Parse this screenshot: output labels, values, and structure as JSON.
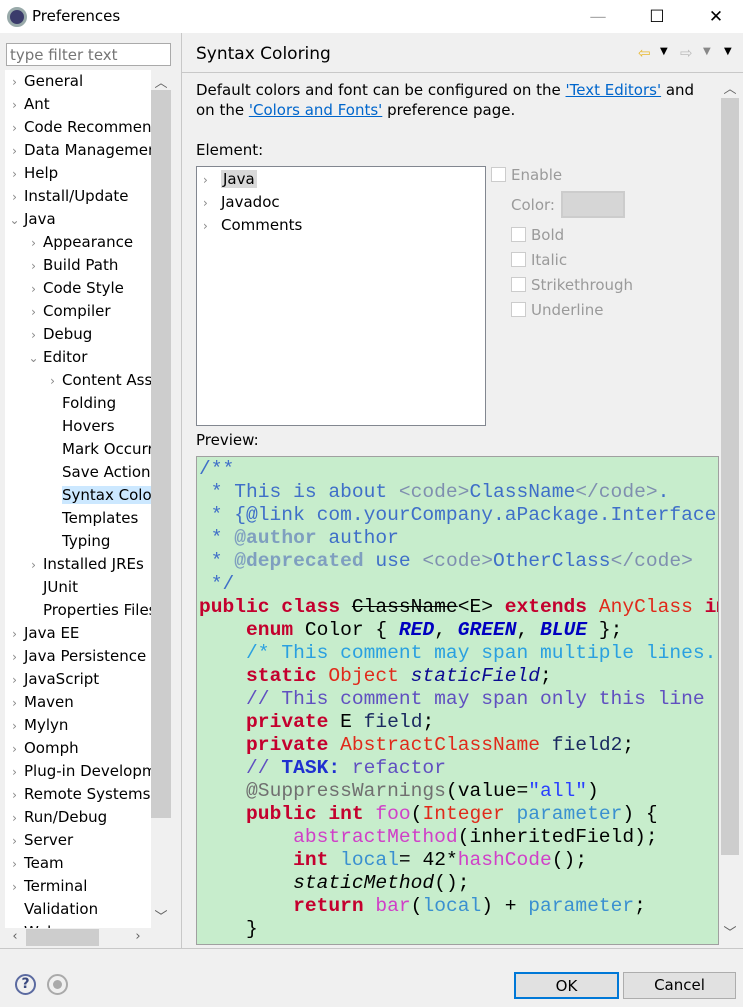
{
  "window": {
    "title": "Preferences",
    "minimize": "—",
    "maximize": "☐",
    "close": "✕"
  },
  "sidebar": {
    "filter_placeholder": "type filter text",
    "items": [
      {
        "label": "General",
        "level": 0,
        "arrow": "closed"
      },
      {
        "label": "Ant",
        "level": 0,
        "arrow": "closed"
      },
      {
        "label": "Code Recommenders",
        "level": 0,
        "arrow": "closed"
      },
      {
        "label": "Data Management",
        "level": 0,
        "arrow": "closed"
      },
      {
        "label": "Help",
        "level": 0,
        "arrow": "closed"
      },
      {
        "label": "Install/Update",
        "level": 0,
        "arrow": "closed"
      },
      {
        "label": "Java",
        "level": 0,
        "arrow": "open"
      },
      {
        "label": "Appearance",
        "level": 1,
        "arrow": "closed"
      },
      {
        "label": "Build Path",
        "level": 1,
        "arrow": "closed"
      },
      {
        "label": "Code Style",
        "level": 1,
        "arrow": "closed"
      },
      {
        "label": "Compiler",
        "level": 1,
        "arrow": "closed"
      },
      {
        "label": "Debug",
        "level": 1,
        "arrow": "closed"
      },
      {
        "label": "Editor",
        "level": 1,
        "arrow": "open"
      },
      {
        "label": "Content Assist",
        "level": 2,
        "arrow": "closed"
      },
      {
        "label": "Folding",
        "level": 2,
        "arrow": "none"
      },
      {
        "label": "Hovers",
        "level": 2,
        "arrow": "none"
      },
      {
        "label": "Mark Occurrences",
        "level": 2,
        "arrow": "none"
      },
      {
        "label": "Save Actions",
        "level": 2,
        "arrow": "none"
      },
      {
        "label": "Syntax Coloring",
        "level": 2,
        "arrow": "none",
        "selected": true
      },
      {
        "label": "Templates",
        "level": 2,
        "arrow": "none"
      },
      {
        "label": "Typing",
        "level": 2,
        "arrow": "none"
      },
      {
        "label": "Installed JREs",
        "level": 1,
        "arrow": "closed"
      },
      {
        "label": "JUnit",
        "level": 1,
        "arrow": "none"
      },
      {
        "label": "Properties Files Editor",
        "level": 1,
        "arrow": "none"
      },
      {
        "label": "Java EE",
        "level": 0,
        "arrow": "closed"
      },
      {
        "label": "Java Persistence",
        "level": 0,
        "arrow": "closed"
      },
      {
        "label": "JavaScript",
        "level": 0,
        "arrow": "closed"
      },
      {
        "label": "Maven",
        "level": 0,
        "arrow": "closed"
      },
      {
        "label": "Mylyn",
        "level": 0,
        "arrow": "closed"
      },
      {
        "label": "Oomph",
        "level": 0,
        "arrow": "closed"
      },
      {
        "label": "Plug-in Development",
        "level": 0,
        "arrow": "closed"
      },
      {
        "label": "Remote Systems",
        "level": 0,
        "arrow": "closed"
      },
      {
        "label": "Run/Debug",
        "level": 0,
        "arrow": "closed"
      },
      {
        "label": "Server",
        "level": 0,
        "arrow": "closed"
      },
      {
        "label": "Team",
        "level": 0,
        "arrow": "closed"
      },
      {
        "label": "Terminal",
        "level": 0,
        "arrow": "closed"
      },
      {
        "label": "Validation",
        "level": 0,
        "arrow": "none"
      },
      {
        "label": "Web",
        "level": 0,
        "arrow": "closed"
      }
    ]
  },
  "page": {
    "title": "Syntax Coloring",
    "nav_icons": [
      "back-arrow-icon",
      "forward-arrow-icon",
      "menu-icon"
    ],
    "desc_before": "Default colors and font can be configured on the ",
    "link_text_editors": "'Text Editors'",
    "desc_middle": " and on the ",
    "link_colors_fonts": "'Colors and Fonts'",
    "desc_after": " preference page.",
    "element_label": "Element:",
    "elements": [
      {
        "label": "Java",
        "selected": true
      },
      {
        "label": "Javadoc"
      },
      {
        "label": "Comments"
      }
    ],
    "enable_label": "Enable",
    "color_label": "Color:",
    "bold_label": "Bold",
    "italic_label": "Italic",
    "strikethrough_label": "Strikethrough",
    "underline_label": "Underline",
    "preview_label": "Preview:",
    "preview_background": "#c7edcc",
    "code": [
      [
        [
          "/**",
          "jd"
        ]
      ],
      [
        [
          " * This is about ",
          "jd"
        ],
        [
          "<code>",
          "ht"
        ],
        [
          "ClassName",
          "jd"
        ],
        [
          "</code>",
          "ht"
        ],
        [
          ".",
          "jd"
        ]
      ],
      [
        [
          " * {@link com.yourCompany.aPackage.Interface}",
          "jd"
        ]
      ],
      [
        [
          " * ",
          "jd"
        ],
        [
          "@author",
          "jt"
        ],
        [
          " author",
          "jd"
        ]
      ],
      [
        [
          " * ",
          "jd"
        ],
        [
          "@deprecated",
          "jt"
        ],
        [
          " use ",
          "jd"
        ],
        [
          "<code>",
          "ht"
        ],
        [
          "OtherClass",
          "jd"
        ],
        [
          "</code>",
          "ht"
        ]
      ],
      [
        [
          " */",
          "jd"
        ]
      ],
      [
        [
          "public class ",
          "k"
        ],
        [
          "ClassName",
          "st pl"
        ],
        [
          "<E> ",
          "pl"
        ],
        [
          "extends ",
          "k"
        ],
        [
          "AnyClass",
          "cls"
        ],
        [
          " implements",
          "k"
        ]
      ],
      [
        [
          "    ",
          "pl"
        ],
        [
          "enum ",
          "k"
        ],
        [
          "Color { ",
          "pl"
        ],
        [
          "RED",
          "en"
        ],
        [
          ", ",
          "pl"
        ],
        [
          "GREEN",
          "en"
        ],
        [
          ", ",
          "pl"
        ],
        [
          "BLUE",
          "en"
        ],
        [
          " };",
          "pl"
        ]
      ],
      [
        [
          "    ",
          "pl"
        ],
        [
          "/* This comment may span multiple lines. */",
          "mc"
        ]
      ],
      [
        [
          "    ",
          "pl"
        ],
        [
          "static ",
          "k"
        ],
        [
          "Object ",
          "cls"
        ],
        [
          "staticField",
          "sf"
        ],
        [
          ";",
          "pl"
        ]
      ],
      [
        [
          "    ",
          "pl"
        ],
        [
          "// This comment may span only this line",
          "sc"
        ]
      ],
      [
        [
          "    ",
          "pl"
        ],
        [
          "private ",
          "k"
        ],
        [
          "E ",
          "pl"
        ],
        [
          "field",
          "fld"
        ],
        [
          ";",
          "pl"
        ]
      ],
      [
        [
          "    ",
          "pl"
        ],
        [
          "private ",
          "k"
        ],
        [
          "AbstractClassName ",
          "cls"
        ],
        [
          "field2",
          "fld"
        ],
        [
          ";",
          "pl"
        ]
      ],
      [
        [
          "    ",
          "pl"
        ],
        [
          "// ",
          "sc"
        ],
        [
          "TASK:",
          "task"
        ],
        [
          " refactor",
          "sc"
        ]
      ],
      [
        [
          "    ",
          "pl"
        ],
        [
          "@SuppressWarnings",
          "ann"
        ],
        [
          "(value=",
          "pl"
        ],
        [
          "\"all\"",
          "str"
        ],
        [
          ")",
          "pl"
        ]
      ],
      [
        [
          "    ",
          "pl"
        ],
        [
          "public int ",
          "k"
        ],
        [
          "foo",
          "md"
        ],
        [
          "(",
          "pl"
        ],
        [
          "Integer ",
          "cls"
        ],
        [
          "parameter",
          "par"
        ],
        [
          ") {",
          "pl"
        ]
      ],
      [
        [
          "        ",
          "pl"
        ],
        [
          "abstractMethod",
          "md"
        ],
        [
          "(inheritedField);",
          "pl"
        ]
      ],
      [
        [
          "        ",
          "pl"
        ],
        [
          "int ",
          "k"
        ],
        [
          "local",
          "par"
        ],
        [
          "= 42*",
          "pl"
        ],
        [
          "hashCode",
          "md"
        ],
        [
          "();",
          "pl"
        ]
      ],
      [
        [
          "        ",
          "pl"
        ],
        [
          "staticMethod",
          "it pl"
        ],
        [
          "();",
          "pl"
        ]
      ],
      [
        [
          "        ",
          "pl"
        ],
        [
          "return ",
          "k"
        ],
        [
          "bar",
          "md"
        ],
        [
          "(",
          "pl"
        ],
        [
          "local",
          "par"
        ],
        [
          ") + ",
          "pl"
        ],
        [
          "parameter",
          "par"
        ],
        [
          ";",
          "pl"
        ]
      ],
      [
        [
          "    }",
          "pl"
        ]
      ]
    ]
  },
  "footer": {
    "ok_label": "OK",
    "cancel_label": "Cancel"
  }
}
